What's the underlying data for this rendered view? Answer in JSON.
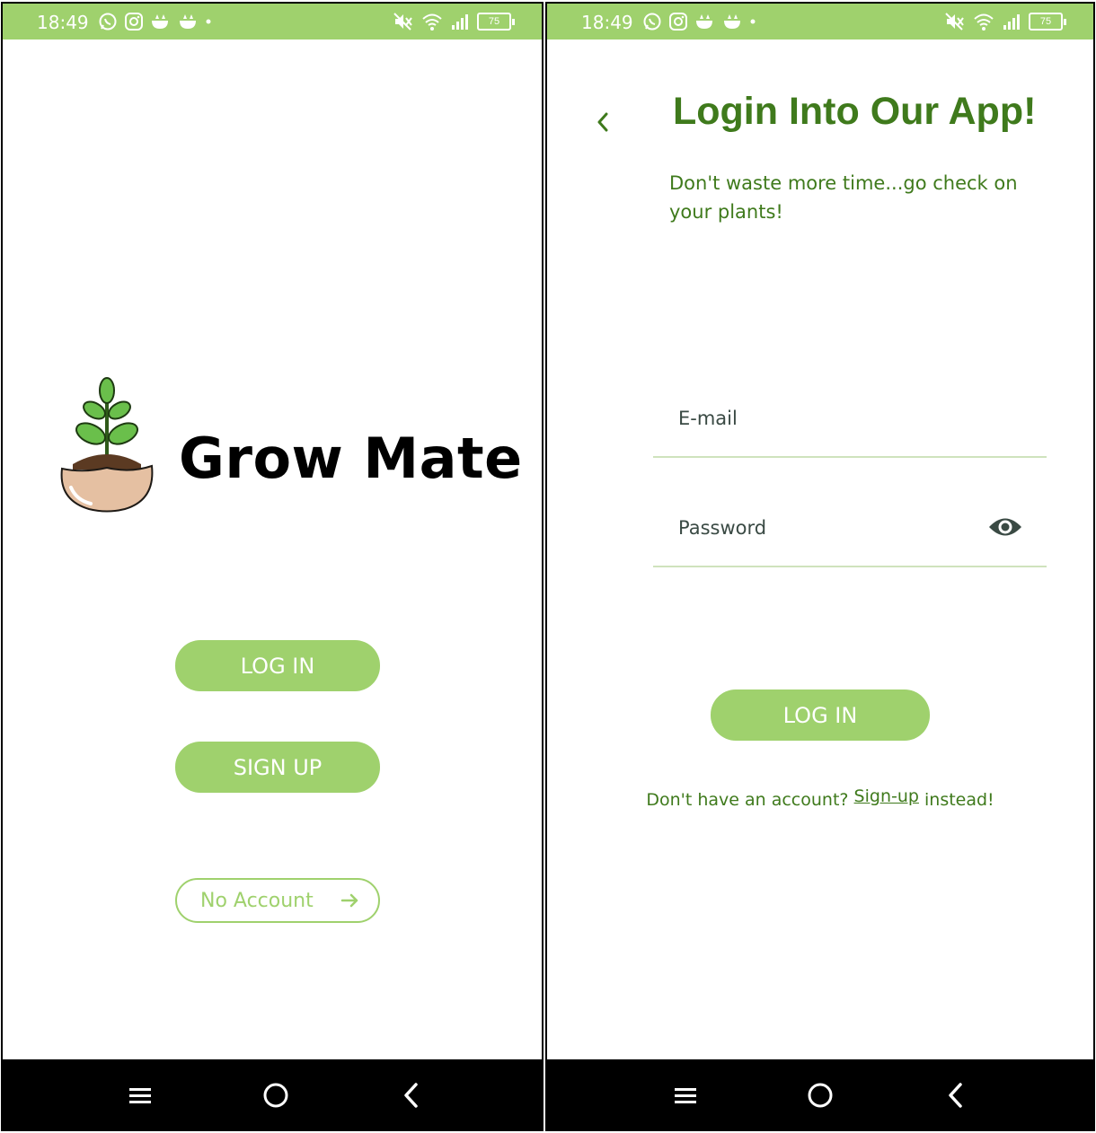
{
  "status_bar": {
    "time": "18:49",
    "battery": "75",
    "app_icons": [
      "whatsapp-icon",
      "instagram-icon",
      "cat-notification-icon",
      "cat-notification-icon"
    ],
    "system_icons": [
      "mute-icon",
      "wifi-icon",
      "signal-icon",
      "battery-icon"
    ],
    "background_color": "#9fd16d"
  },
  "welcome_screen": {
    "logo_icon": "plant-pot-logo-icon",
    "app_name": "Grow Mate",
    "login_button": "LOG IN",
    "signup_button": "SIGN UP",
    "no_account_button": "No Account",
    "no_account_icon": "arrow-right-icon"
  },
  "login_screen": {
    "back_icon": "chevron-left-icon",
    "title": "Login Into Our App!",
    "subtitle": "Don't waste more time...go check on your plants!",
    "email_label": "E-mail",
    "password_label": "Password",
    "password_visibility_icon": "eye-icon",
    "login_button": "LOG IN",
    "signup_prompt_prefix": "Don't have an account? ",
    "signup_link": "Sign-up",
    "signup_prompt_suffix": " instead!"
  },
  "nav_bar": {
    "icons": [
      "menu-icon",
      "home-icon",
      "back-icon"
    ]
  },
  "colors": {
    "accent": "#9fd16d",
    "title_green": "#3f7a1c",
    "nav_background": "#000000"
  }
}
